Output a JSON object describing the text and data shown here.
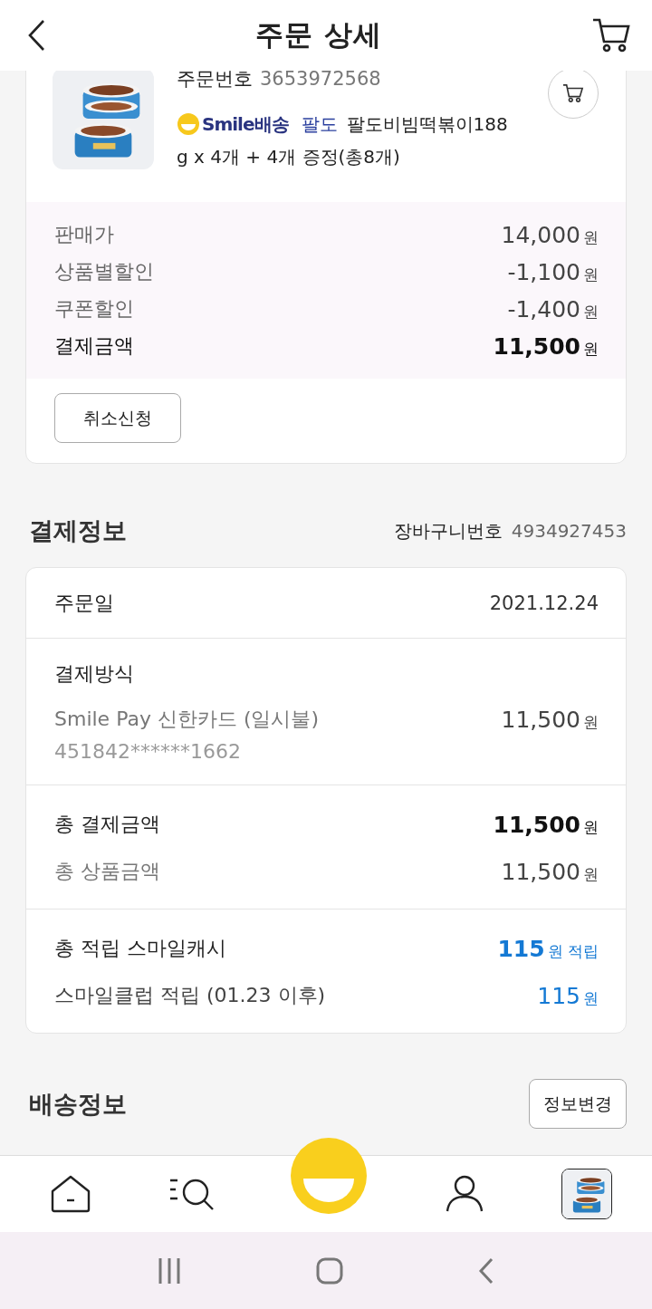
{
  "header": {
    "title": "주문 상세"
  },
  "order": {
    "number_label": "주문번호",
    "number": "3653972568",
    "delivery": "Smile배송",
    "brand": "팔도",
    "name_lines": [
      "팔도비빔떡볶이188",
      "g x 4개 + 4개 증정(총8개)"
    ]
  },
  "prices": [
    {
      "label": "판매가",
      "amount": "14,000",
      "unit": "원",
      "emphasis": false
    },
    {
      "label": "상품별할인",
      "amount": "-1,100",
      "unit": "원",
      "emphasis": false
    },
    {
      "label": "쿠폰할인",
      "amount": "-1,400",
      "unit": "원",
      "emphasis": false
    },
    {
      "label": "결제금액",
      "amount": "11,500",
      "unit": "원",
      "emphasis": true
    }
  ],
  "cancel_button": "취소신청",
  "payment": {
    "title": "결제정보",
    "cart_number_label": "장바구니번호",
    "cart_number": "4934927453",
    "order_date_label": "주문일",
    "order_date": "2021.12.24",
    "method_label": "결제방식",
    "method": "Smile Pay 신한카드 (일시불)",
    "method_amount": "11,500",
    "method_unit": "원",
    "card_number": "451842******1662",
    "totals": [
      {
        "label": "총 결제금액",
        "amount": "11,500",
        "unit": "원",
        "emphasis": true
      },
      {
        "label": "총 상품금액",
        "amount": "11,500",
        "unit": "원",
        "emphasis": false
      }
    ],
    "points": [
      {
        "label": "총 적립 스마일캐시",
        "amount": "115",
        "unit": "원 적립",
        "emphasis": true
      },
      {
        "label": "스마일클럽 적립 (01.23 이후)",
        "amount": "115",
        "unit": "원",
        "emphasis": false
      }
    ]
  },
  "shipping": {
    "title": "배송정보",
    "change_button": "정보변경"
  },
  "nav": [
    {
      "kind": "home"
    },
    {
      "kind": "search"
    },
    {
      "kind": "smile"
    },
    {
      "kind": "profile"
    },
    {
      "kind": "recent"
    }
  ]
}
